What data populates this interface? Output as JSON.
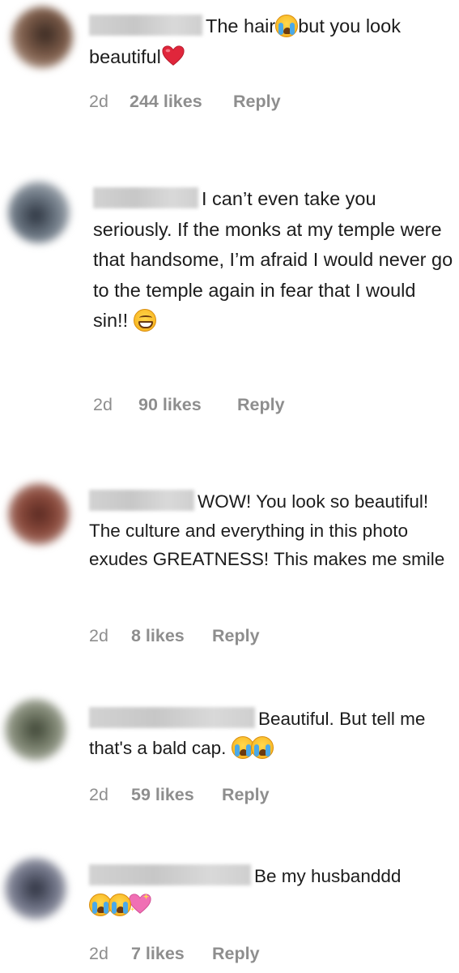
{
  "colors": {
    "meta_text": "#8e8e8e",
    "body_text": "#1c1c1c",
    "username_redaction": "#cfcfcf"
  },
  "comments": [
    {
      "username": "",
      "text_before": "The hair",
      "emoji_1": "loudly-crying-face-emoji",
      "text_after": "but you look beautiful",
      "emoji_2": "red-heart-emoji",
      "time": "2d",
      "likes": "244 likes",
      "reply": "Reply"
    },
    {
      "username": "",
      "text": "I can’t even take you seriously. If the monks at my temple were that handsome, I’m afraid I would never go to the temple again in fear that I would sin!! ",
      "emoji_1": "grinning-face-emoji",
      "time": "2d",
      "likes": "90 likes",
      "reply": "Reply"
    },
    {
      "username": "",
      "text": "WOW! You look so beautiful! The culture and everything in this photo exudes GREATNESS! This makes me smile",
      "time": "2d",
      "likes": "8 likes",
      "reply": "Reply"
    },
    {
      "username": "",
      "text": "Beautiful. But tell me that's a bald cap. ",
      "emoji_1": "loudly-crying-face-emoji",
      "emoji_2": "loudly-crying-face-emoji",
      "time": "2d",
      "likes": "59 likes",
      "reply": "Reply"
    },
    {
      "username": "",
      "text": "Be my husbanddd",
      "emoji_1": "loudly-crying-face-emoji",
      "emoji_2": "loudly-crying-face-emoji",
      "emoji_3": "sparkling-heart-emoji",
      "time": "2d",
      "likes": "7 likes",
      "reply": "Reply"
    }
  ]
}
